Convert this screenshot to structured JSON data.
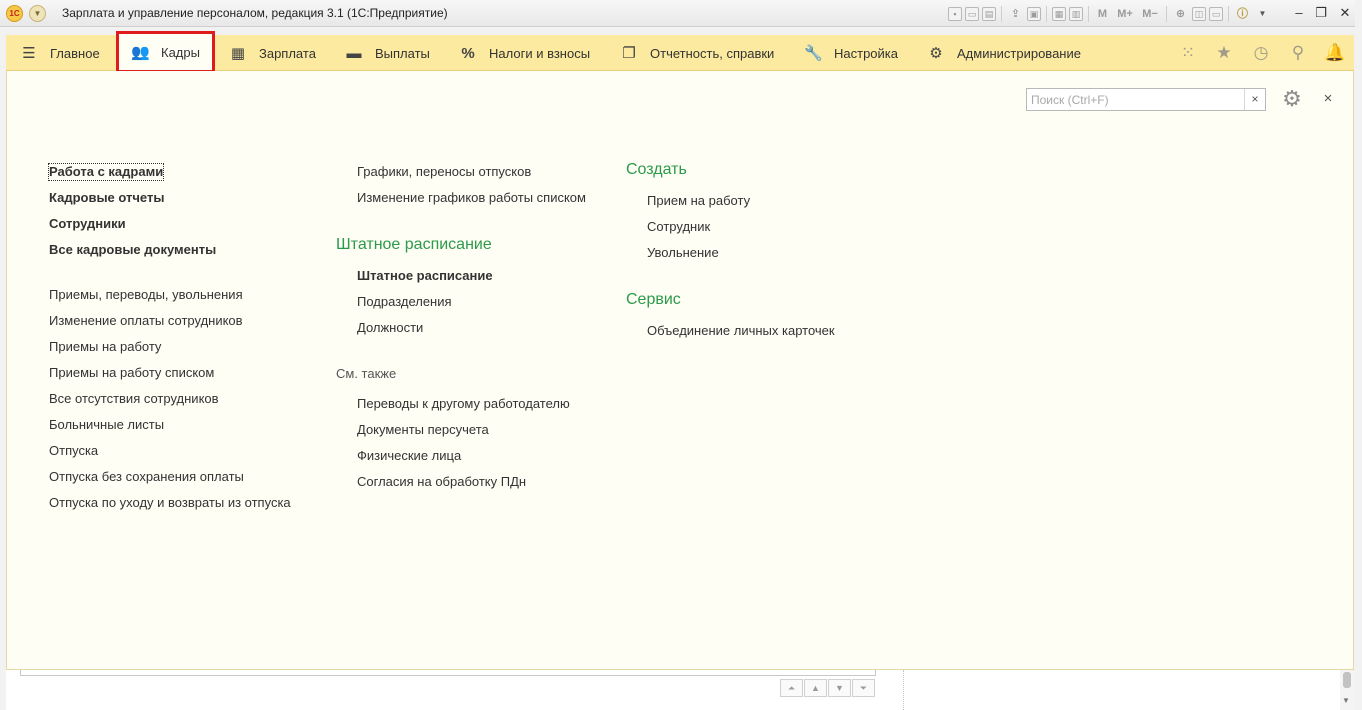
{
  "titlebar": {
    "title": "Зарплата и управление персоналом, редакция 3.1  (1С:Предприятие)",
    "logo_text": "1С",
    "toolbar_glyphs": [
      "M",
      "M+",
      "M−"
    ],
    "icons": [
      "save-icon",
      "print-icon",
      "print-preview-icon",
      "upload-icon",
      "save-copy-icon",
      "calculator-icon",
      "calendar-icon",
      "zoom-icon",
      "compare-icon",
      "window-icon",
      "info-icon",
      "dropdown-icon",
      "minimize-icon",
      "restore-icon",
      "close-icon"
    ]
  },
  "sections": {
    "items": [
      {
        "label": "Главное",
        "icon": "hamburger-icon"
      },
      {
        "label": "Кадры",
        "icon": "people-icon",
        "active": true
      },
      {
        "label": "Зарплата",
        "icon": "calculator-icon"
      },
      {
        "label": "Выплаты",
        "icon": "wallet-icon"
      },
      {
        "label": "Налоги и взносы",
        "icon": "percent-icon"
      },
      {
        "label": "Отчетность, справки",
        "icon": "reports-icon"
      },
      {
        "label": "Настройка",
        "icon": "wrench-icon"
      },
      {
        "label": "Администрирование",
        "icon": "gear-icon"
      }
    ],
    "right_icons": [
      "apps-grid-icon",
      "favorites-star-icon",
      "history-icon",
      "search-icon",
      "notifications-bell-icon"
    ]
  },
  "panel": {
    "search": {
      "placeholder": "Поиск (Ctrl+F)",
      "value": "",
      "clear": "×"
    },
    "close": "×",
    "col1": {
      "main_links": [
        "Работа с кадрами",
        "Кадровые отчеты",
        "Сотрудники",
        "Все кадровые документы"
      ],
      "links": [
        "Приемы, переводы, увольнения",
        "Изменение оплаты сотрудников",
        "Приемы на работу",
        "Приемы на работу списком",
        "Все отсутствия сотрудников",
        "Больничные листы",
        "Отпуска",
        "Отпуска без сохранения оплаты",
        "Отпуска по уходу и возвраты из отпуска"
      ]
    },
    "col2": {
      "top_links": [
        "Графики, переносы отпусков",
        "Изменение графиков работы списком"
      ],
      "staff_group": {
        "title": "Штатное расписание",
        "links": [
          "Штатное расписание",
          "Подразделения",
          "Должности"
        ]
      },
      "see_also": {
        "title": "См. также",
        "links": [
          "Переводы к другому работодателю",
          "Документы персучета",
          "Физические лица",
          "Согласия на обработку ПДн"
        ]
      }
    },
    "col3": {
      "create_group": {
        "title": "Создать",
        "links": [
          "Прием на работу",
          "Сотрудник",
          "Увольнение"
        ]
      },
      "service_group": {
        "title": "Сервис",
        "links": [
          "Объединение личных карточек"
        ]
      }
    }
  },
  "bottom": {
    "nav_buttons": [
      "⏶",
      "▲",
      "▼",
      "⏷"
    ]
  }
}
